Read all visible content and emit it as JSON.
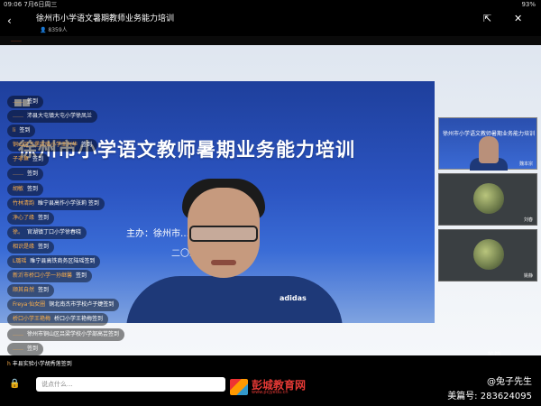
{
  "status_bar": {
    "time": "09:06",
    "date": "7月6日周三",
    "battery": "93%"
  },
  "header": {
    "title": "徐州市小学语文暑期教师业务能力培训",
    "viewers": "8359人"
  },
  "banner_text": "……",
  "slide": {
    "title": "徐州市小学语文教师暑期业务能力培训",
    "organizer": "主办：徐州市……院",
    "year": "二〇二二"
  },
  "chat": [
    {
      "name": "……",
      "msg": "签到"
    },
    {
      "name": "……",
      "msg": "沛县大屯镇大屯小学徐凤兰"
    },
    {
      "name": "li",
      "msg": "签到"
    },
    {
      "name": "铜山区三堡实验小学王兴华",
      "msg": "签到"
    },
    {
      "name": "子非鱼",
      "msg": "签到"
    },
    {
      "name": "……",
      "msg": "签到"
    },
    {
      "name": "胡敏",
      "msg": "签到"
    },
    {
      "name": "竹林清韵",
      "msg": "睢宁县高作小学张莉    签到"
    },
    {
      "name": "净心了缘",
      "msg": "签到"
    },
    {
      "name": "徐。",
      "msg": "官湖镇丁口小学徐春晓"
    },
    {
      "name": "相识是缘",
      "msg": "签到"
    },
    {
      "name": "L璐瑶",
      "msg": "睢宁县高铁商务区陆瑶签到"
    },
    {
      "name": "新沂市桥口小学一孙继馨",
      "msg": "签到"
    },
    {
      "name": "顺其自然",
      "msg": "签到"
    },
    {
      "name": "Freya·仙女圈",
      "msg": "铜北南杰市学校卢子婕签到"
    },
    {
      "name": "桥口小学王艳梅",
      "msg": "桥口小学王艳梅签到"
    },
    {
      "name": "……",
      "msg": "徐州市铜山区吕梁学校小学部高芸签到"
    },
    {
      "name": "……",
      "msg": "签到"
    }
  ],
  "thumbnails": [
    {
      "label": "魏本宗",
      "title": "徐州市小学语文教师暑期业务能力培训"
    },
    {
      "label": "刘春"
    },
    {
      "label": "姚静"
    }
  ],
  "footer": {
    "last_chat_name": "h",
    "last_chat_msg": "丰县实验小学胡秀莲签到",
    "input_placeholder": "说点什么...",
    "brand": "彭城教育网",
    "url": "www.pcjyedu.cn",
    "author": "@兔子先生",
    "meipian_id": "美篇号: 283624095"
  },
  "watermark": "美篇",
  "colors": {
    "accent_name": "#ffb04a",
    "brand_red": "#e53935",
    "slide_blue": "#2c55c2"
  }
}
